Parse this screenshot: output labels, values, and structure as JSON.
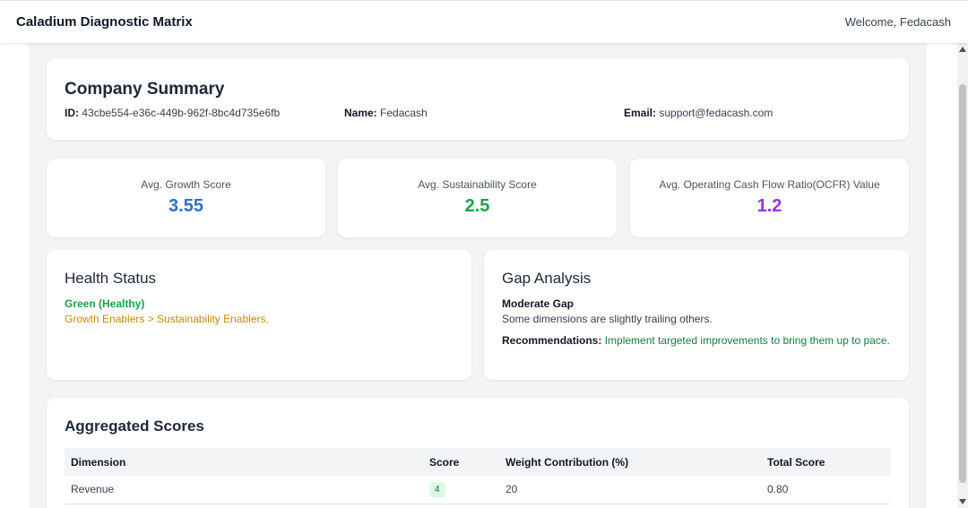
{
  "header": {
    "app_title": "Caladium Diagnostic Matrix",
    "welcome": "Welcome, Fedacash"
  },
  "summary": {
    "title": "Company Summary",
    "id_label": "ID:",
    "id_value": "43cbe554-e36c-449b-962f-8bc4d735e6fb",
    "name_label": "Name:",
    "name_value": "Fedacash",
    "email_label": "Email:",
    "email_value": "support@fedacash.com"
  },
  "metrics": [
    {
      "label": "Avg. Growth Score",
      "value": "3.55",
      "color": "#2f6fd0"
    },
    {
      "label": "Avg. Sustainability Score",
      "value": "2.5",
      "color": "#16a34a"
    },
    {
      "label": "Avg. Operating Cash Flow Ratio(OCFR) Value",
      "value": "1.2",
      "color": "#9333ea"
    }
  ],
  "health": {
    "title": "Health Status",
    "status": "Green (Healthy)",
    "status_color": "#16a34a",
    "detail": "Growth Enablers > Sustainability Enablers.",
    "detail_color": "#ca8a04"
  },
  "gap": {
    "title": "Gap Analysis",
    "level": "Moderate Gap",
    "description": "Some dimensions are slightly trailing others.",
    "recommendations_label": "Recommendations:",
    "recommendations_text": "Implement targeted improvements to bring them up to pace.",
    "recommendations_color": "#15803d"
  },
  "aggregated": {
    "title": "Aggregated Scores",
    "columns": [
      "Dimension",
      "Score",
      "Weight Contribution (%)",
      "Total Score"
    ],
    "rows": [
      {
        "dimension": "Revenue",
        "score": "4",
        "weight": "20",
        "total": "0.80"
      }
    ]
  }
}
